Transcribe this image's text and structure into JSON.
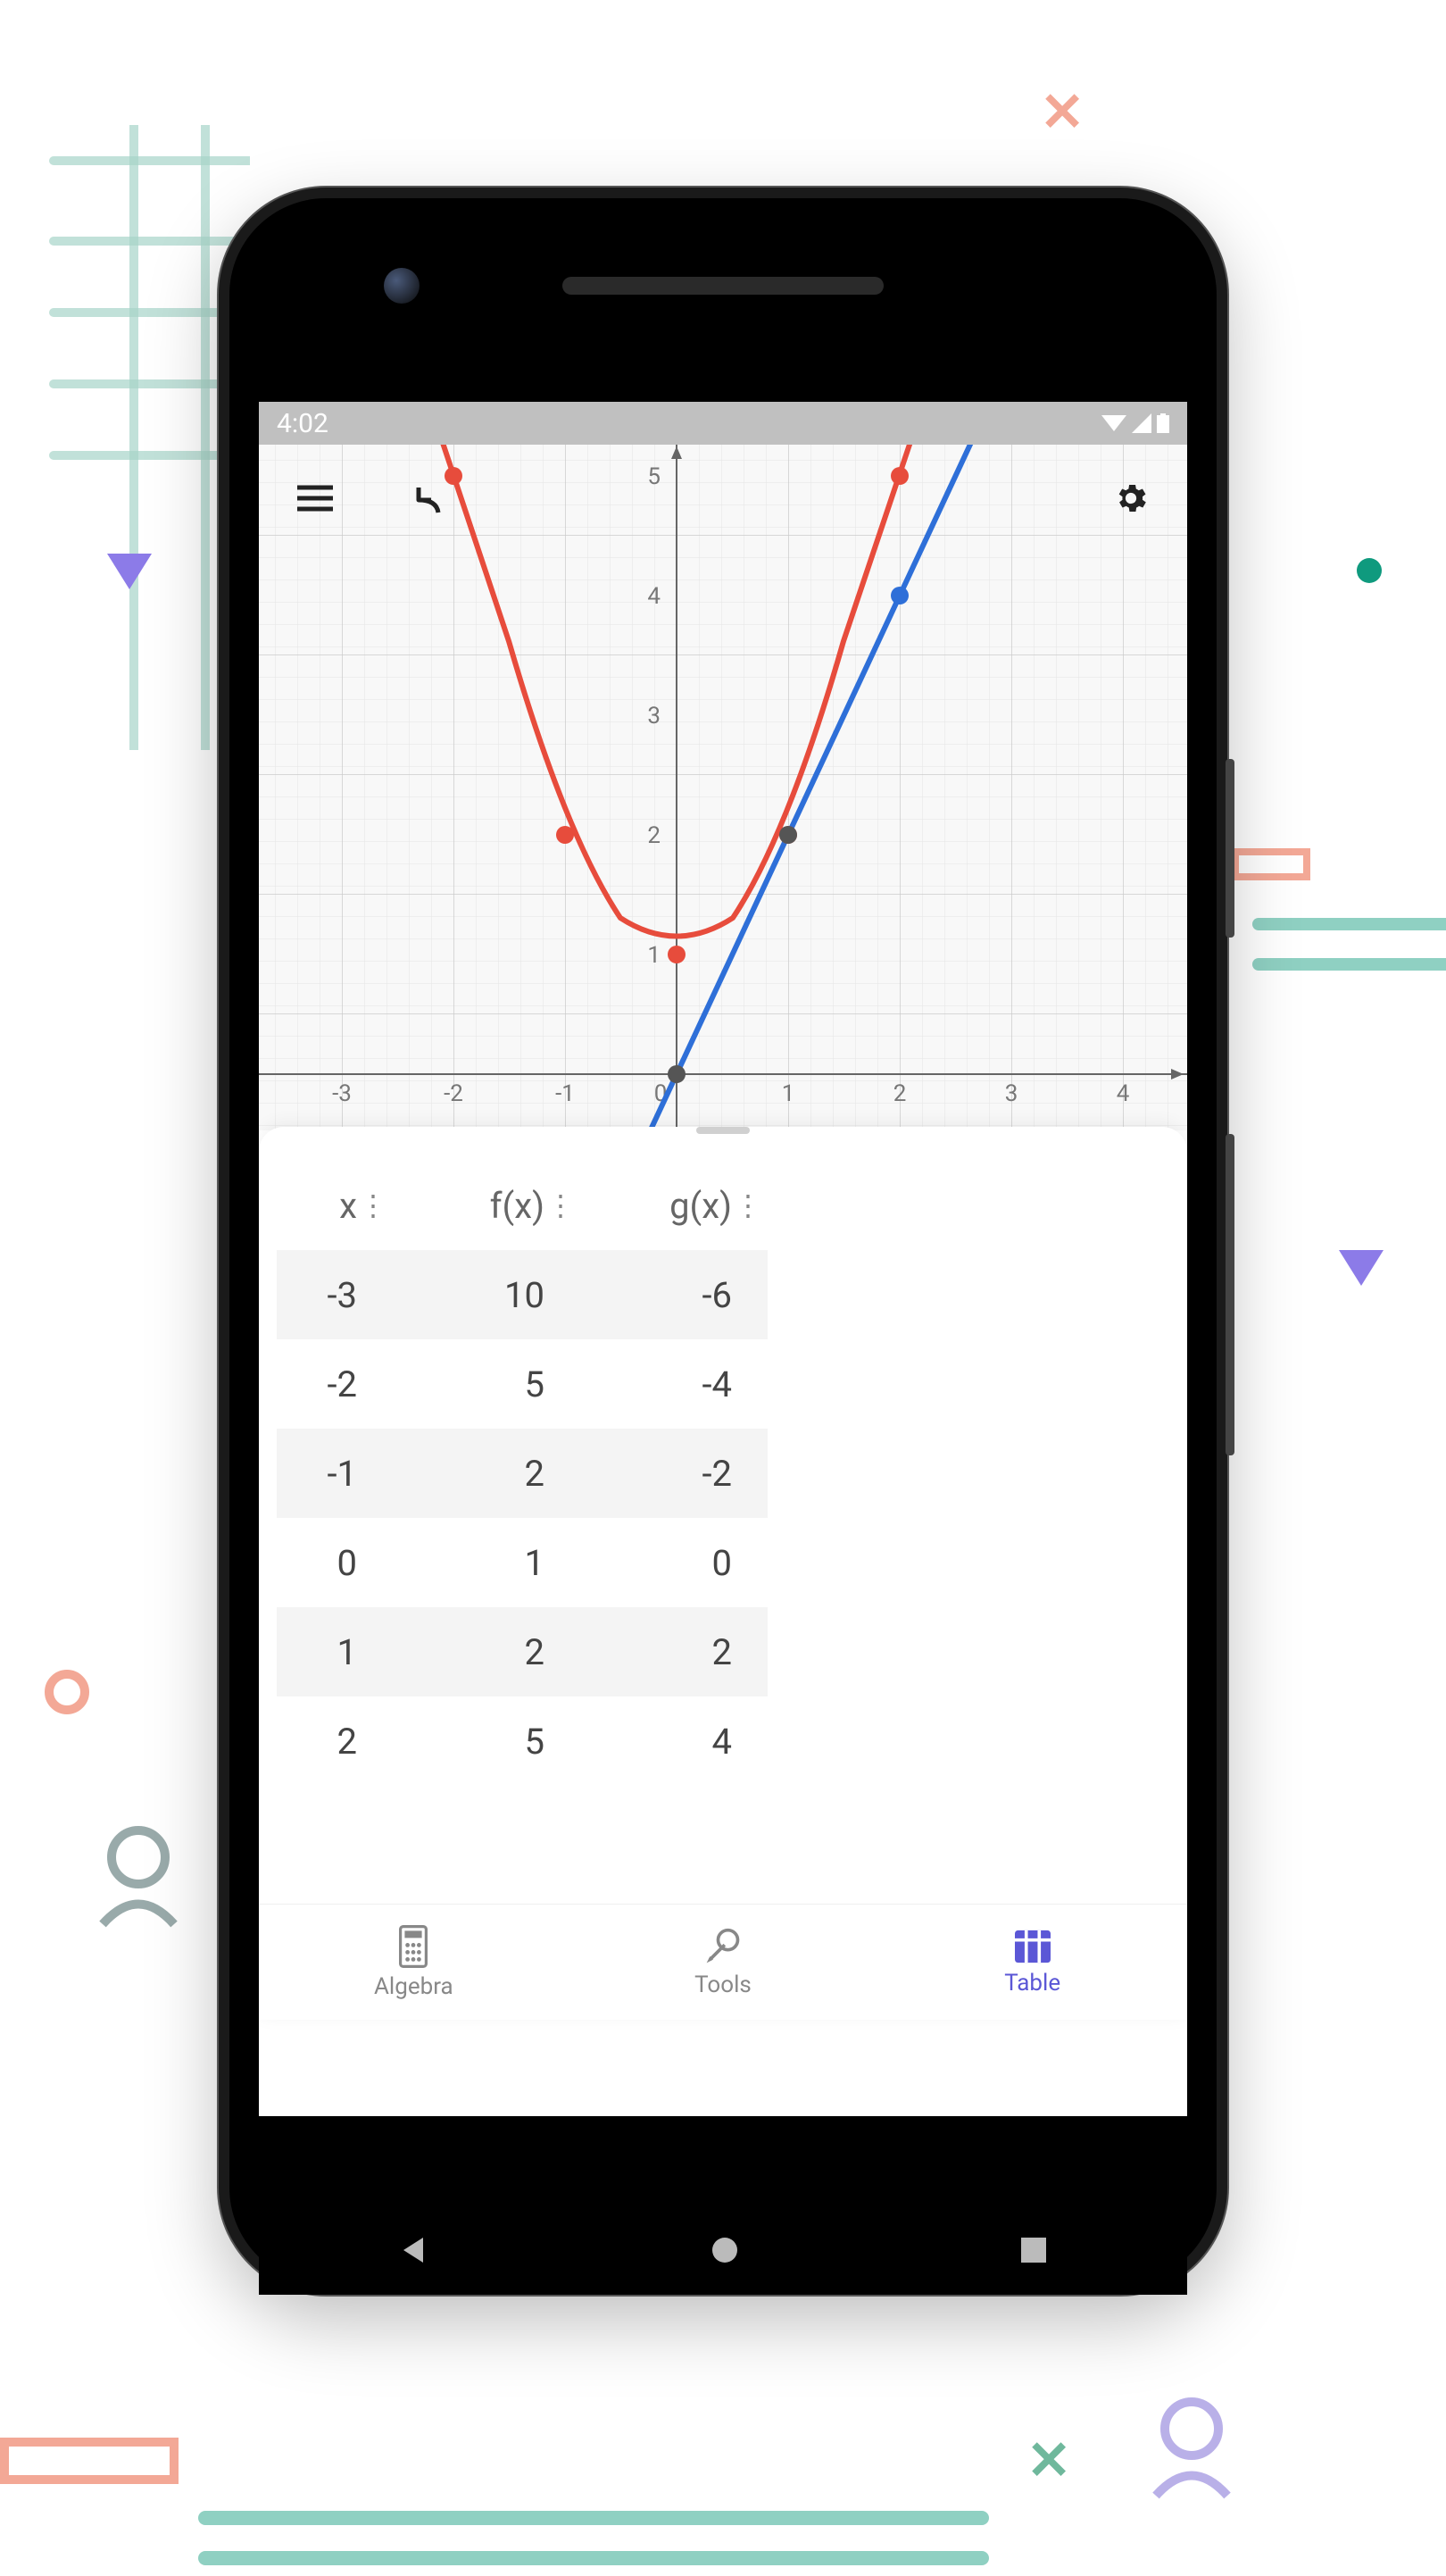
{
  "statusbar": {
    "time": "4:02"
  },
  "chart_data": {
    "type": "line",
    "xlim": [
      -3.5,
      4.5
    ],
    "ylim": [
      -0.5,
      5.5
    ],
    "x_ticks": [
      -3,
      -2,
      -1,
      0,
      1,
      2,
      3,
      4
    ],
    "y_ticks": [
      1,
      2,
      3,
      4,
      5
    ],
    "series": [
      {
        "name": "f(x)",
        "color": "#e74c3c",
        "type": "curve",
        "formula": "x^2 + 1",
        "x": [
          -3,
          -2,
          -1,
          0,
          1,
          2
        ],
        "y": [
          10,
          5,
          2,
          1,
          2,
          5
        ],
        "marked_points": [
          [
            -2,
            5
          ],
          [
            -1,
            2
          ],
          [
            0,
            1
          ],
          [
            1,
            2
          ],
          [
            2,
            5
          ]
        ]
      },
      {
        "name": "g(x)",
        "color": "#2e6fd8",
        "type": "line",
        "formula": "2x",
        "x": [
          -3,
          -2,
          -1,
          0,
          1,
          2
        ],
        "y": [
          -6,
          -4,
          -2,
          0,
          2,
          4
        ],
        "marked_points": [
          [
            0,
            0
          ],
          [
            1,
            2
          ],
          [
            2,
            4
          ]
        ]
      }
    ]
  },
  "table": {
    "columns": [
      "x",
      "f(x)",
      "g(x)"
    ],
    "rows": [
      {
        "x": "-3",
        "f": "10",
        "g": "-6"
      },
      {
        "x": "-2",
        "f": "5",
        "g": "-4"
      },
      {
        "x": "-1",
        "f": "2",
        "g": "-2"
      },
      {
        "x": "0",
        "f": "1",
        "g": "0"
      },
      {
        "x": "1",
        "f": "2",
        "g": "2"
      },
      {
        "x": "2",
        "f": "5",
        "g": "4"
      }
    ]
  },
  "nav": {
    "items": [
      {
        "id": "algebra",
        "label": "Algebra",
        "active": false
      },
      {
        "id": "tools",
        "label": "Tools",
        "active": false
      },
      {
        "id": "table",
        "label": "Table",
        "active": true
      }
    ]
  }
}
